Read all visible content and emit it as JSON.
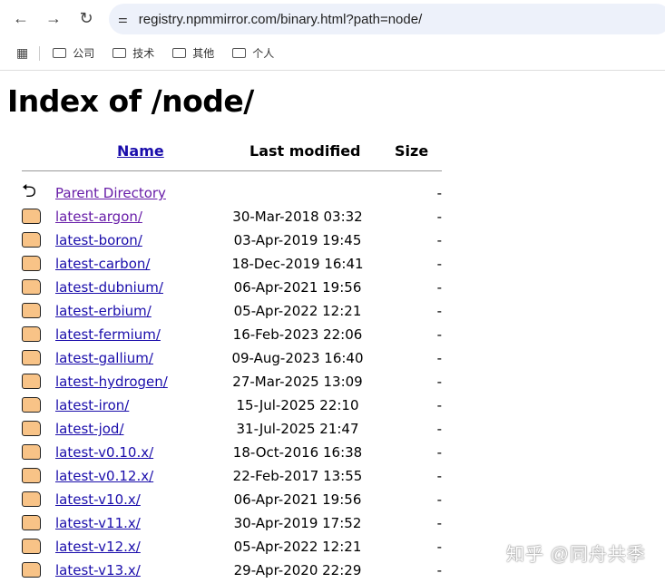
{
  "browser": {
    "url": "registry.npmmirror.com/binary.html?path=node/",
    "bookmarks": [
      "公司",
      "技术",
      "其他",
      "个人"
    ]
  },
  "page": {
    "title": "Index of /node/",
    "headers": {
      "name": "Name",
      "modified": "Last modified",
      "size": "Size"
    },
    "rows": [
      {
        "name": "Parent Directory",
        "date": "",
        "size": "-",
        "type": "parent",
        "visited": true
      },
      {
        "name": "latest-argon/",
        "date": "30-Mar-2018 03:32",
        "size": "-",
        "visited": true
      },
      {
        "name": "latest-boron/",
        "date": "03-Apr-2019 19:45",
        "size": "-"
      },
      {
        "name": "latest-carbon/",
        "date": "18-Dec-2019 16:41",
        "size": "-"
      },
      {
        "name": "latest-dubnium/",
        "date": "06-Apr-2021 19:56",
        "size": "-"
      },
      {
        "name": "latest-erbium/",
        "date": "05-Apr-2022 12:21",
        "size": "-"
      },
      {
        "name": "latest-fermium/",
        "date": "16-Feb-2023 22:06",
        "size": "-"
      },
      {
        "name": "latest-gallium/",
        "date": "09-Aug-2023 16:40",
        "size": "-"
      },
      {
        "name": "latest-hydrogen/",
        "date": "27-Mar-2025 13:09",
        "size": "-"
      },
      {
        "name": "latest-iron/",
        "date": "15-Jul-2025 22:10",
        "size": "-"
      },
      {
        "name": "latest-jod/",
        "date": "31-Jul-2025 21:47",
        "size": "-"
      },
      {
        "name": "latest-v0.10.x/",
        "date": "18-Oct-2016 16:38",
        "size": "-"
      },
      {
        "name": "latest-v0.12.x/",
        "date": "22-Feb-2017 13:55",
        "size": "-"
      },
      {
        "name": "latest-v10.x/",
        "date": "06-Apr-2021 19:56",
        "size": "-"
      },
      {
        "name": "latest-v11.x/",
        "date": "30-Apr-2019 17:52",
        "size": "-"
      },
      {
        "name": "latest-v12.x/",
        "date": "05-Apr-2022 12:21",
        "size": "-"
      },
      {
        "name": "latest-v13.x/",
        "date": "29-Apr-2020 22:29",
        "size": "-"
      }
    ]
  },
  "watermark": "知乎 @同舟共季"
}
